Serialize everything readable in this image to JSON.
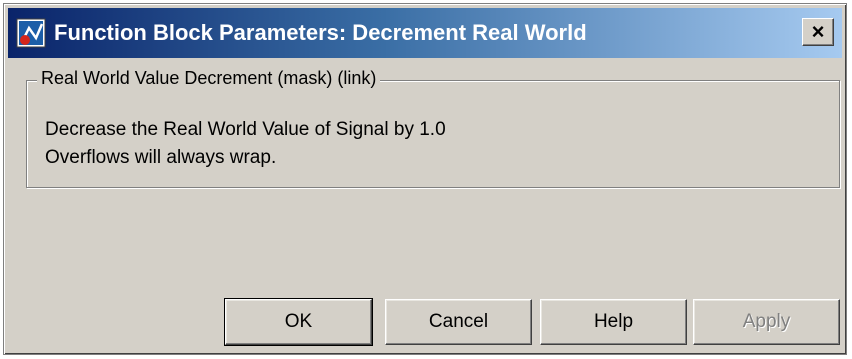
{
  "window": {
    "title": "Function Block Parameters: Decrement Real World",
    "close_label": "×"
  },
  "group": {
    "legend": "Real World Value Decrement (mask) (link)",
    "line1": "Decrease the Real World Value of Signal by 1.0",
    "line2": "Overflows will always wrap."
  },
  "buttons": {
    "ok": "OK",
    "cancel": "Cancel",
    "help": "Help",
    "apply": "Apply"
  },
  "colors": {
    "title_gradient_start": "#0a246a",
    "title_gradient_end": "#a6caf0",
    "face": "#d4d0c8"
  },
  "icons": {
    "title": "simulink-block-icon",
    "close": "close-icon"
  }
}
